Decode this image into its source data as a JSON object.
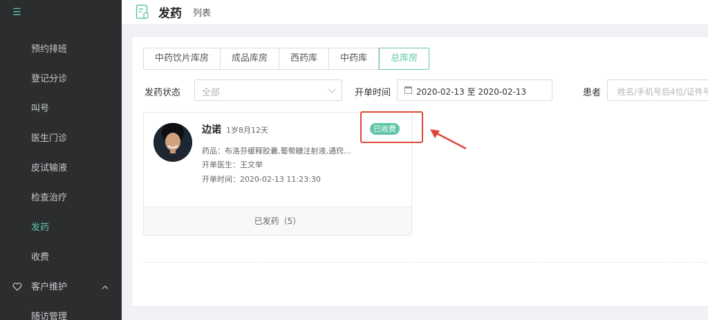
{
  "sidebar": {
    "logo": "☰",
    "items": [
      {
        "label": "预约排班"
      },
      {
        "label": "登记分诊"
      },
      {
        "label": "叫号"
      },
      {
        "label": "医生门诊"
      },
      {
        "label": "皮试输液"
      },
      {
        "label": "检查治疗"
      },
      {
        "label": "发药",
        "active": true
      },
      {
        "label": "收费"
      }
    ],
    "group": {
      "label": "客户维护",
      "icon": "heart-icon",
      "expanded": true
    },
    "sub_items": [
      {
        "label": "随访管理"
      }
    ]
  },
  "header": {
    "icon": "document-icon",
    "title": "发药",
    "subtitle": "列表"
  },
  "tabs": [
    {
      "label": "中药饮片库房"
    },
    {
      "label": "成品库房"
    },
    {
      "label": "西药库"
    },
    {
      "label": "中药库"
    },
    {
      "label": "总库房",
      "active": true
    }
  ],
  "filters": {
    "status_label": "发药状态",
    "status_placeholder": "全部",
    "time_label": "开单时间",
    "date_range": "2020-02-13 至 2020-02-13",
    "patient_label": "患者",
    "patient_placeholder": "姓名/手机号后4位/证件号"
  },
  "card": {
    "name": "边诺",
    "age": "1岁8月12天",
    "badge": "已收费",
    "drugs": "药品：布洛芬缓释胶囊,葡萄糖注射液,通窍…",
    "doctor": "开单医生：王文举",
    "time": "开单时间：2020-02-13 11:23:30",
    "footer": "已发药（5）"
  },
  "colors": {
    "accent": "#5fc5a7",
    "sidebar_bg": "#2b2d2f",
    "annotation": "#e0453a"
  }
}
